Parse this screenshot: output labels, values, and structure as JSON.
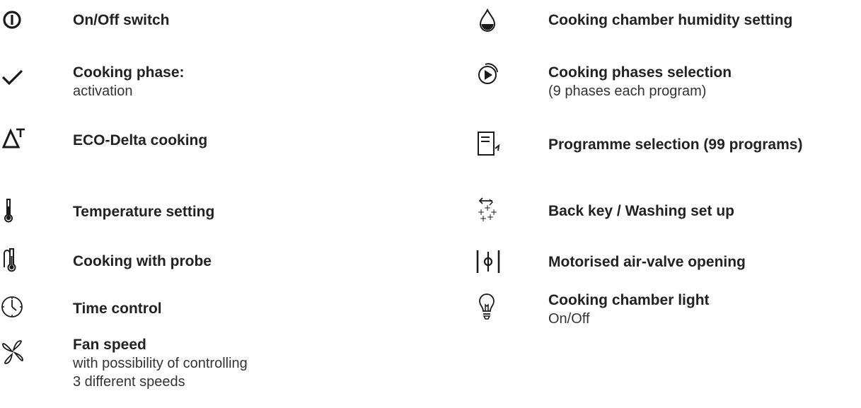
{
  "left_column": [
    {
      "icon": "power-icon",
      "title": "On/Off switch",
      "lines": []
    },
    {
      "icon": "checkmark-icon",
      "title": "Cooking phase:",
      "lines": [
        "activation"
      ]
    },
    {
      "icon": "delta-t-icon",
      "title": "ECO-Delta cooking",
      "lines": []
    },
    {
      "icon": "thermometer-icon",
      "title": "Temperature setting",
      "lines": []
    },
    {
      "icon": "probe-thermometer-icon",
      "title": "Cooking with probe",
      "lines": []
    },
    {
      "icon": "clock-icon",
      "title": "Time control",
      "lines": []
    },
    {
      "icon": "fan-icon",
      "title": "Fan speed",
      "lines": [
        "with possibility of controlling",
        "3 different speeds"
      ]
    }
  ],
  "right_column": [
    {
      "icon": "water-drop-icon",
      "title": "Cooking chamber humidity setting",
      "lines": []
    },
    {
      "icon": "phases-play-icon",
      "title": "Cooking phases selection",
      "lines": [
        "(9 phases each program)"
      ]
    },
    {
      "icon": "program-document-icon",
      "title": "Programme selection (99 programs)",
      "lines": []
    },
    {
      "icon": "back-wash-icon",
      "title": "Back key / Washing set up",
      "lines": []
    },
    {
      "icon": "air-valve-icon",
      "title": "Motorised air-valve opening",
      "lines": []
    },
    {
      "icon": "light-bulb-icon",
      "title": "Cooking chamber light",
      "lines": [
        "On/Off"
      ]
    }
  ]
}
